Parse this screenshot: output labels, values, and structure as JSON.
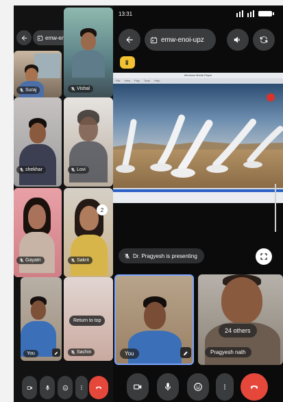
{
  "left_phone": {
    "meeting_code": "emw-enoi-upz",
    "participants": [
      {
        "name": "Suraj"
      },
      {
        "name": "Vishal"
      },
      {
        "name": "shekhar"
      },
      {
        "name": "Lovi"
      },
      {
        "name": "Gayatri"
      },
      {
        "name": "Sakrit"
      },
      {
        "name": "You"
      },
      {
        "name": "Sachin"
      }
    ],
    "badge_count": "2",
    "tooltip": "Return to top"
  },
  "right_phone": {
    "status_time": "13:31",
    "meeting_code": "emw-enoi-upz",
    "media_player_title": "Windows Media Player",
    "media_menu": [
      "File",
      "View",
      "Play",
      "Tools",
      "Help"
    ],
    "presenting_label": "Dr. Pragyesh is presenting",
    "self_label": "You",
    "others_label": "24 others",
    "pinned_name": "Pragyesh nath"
  },
  "colors": {
    "panel_bg": "#0f0f10",
    "control_bg": "#3a3b3d",
    "hangup": "#e5483b",
    "hand_badge": "#f2c233",
    "tile_border": "#7da7ff"
  }
}
